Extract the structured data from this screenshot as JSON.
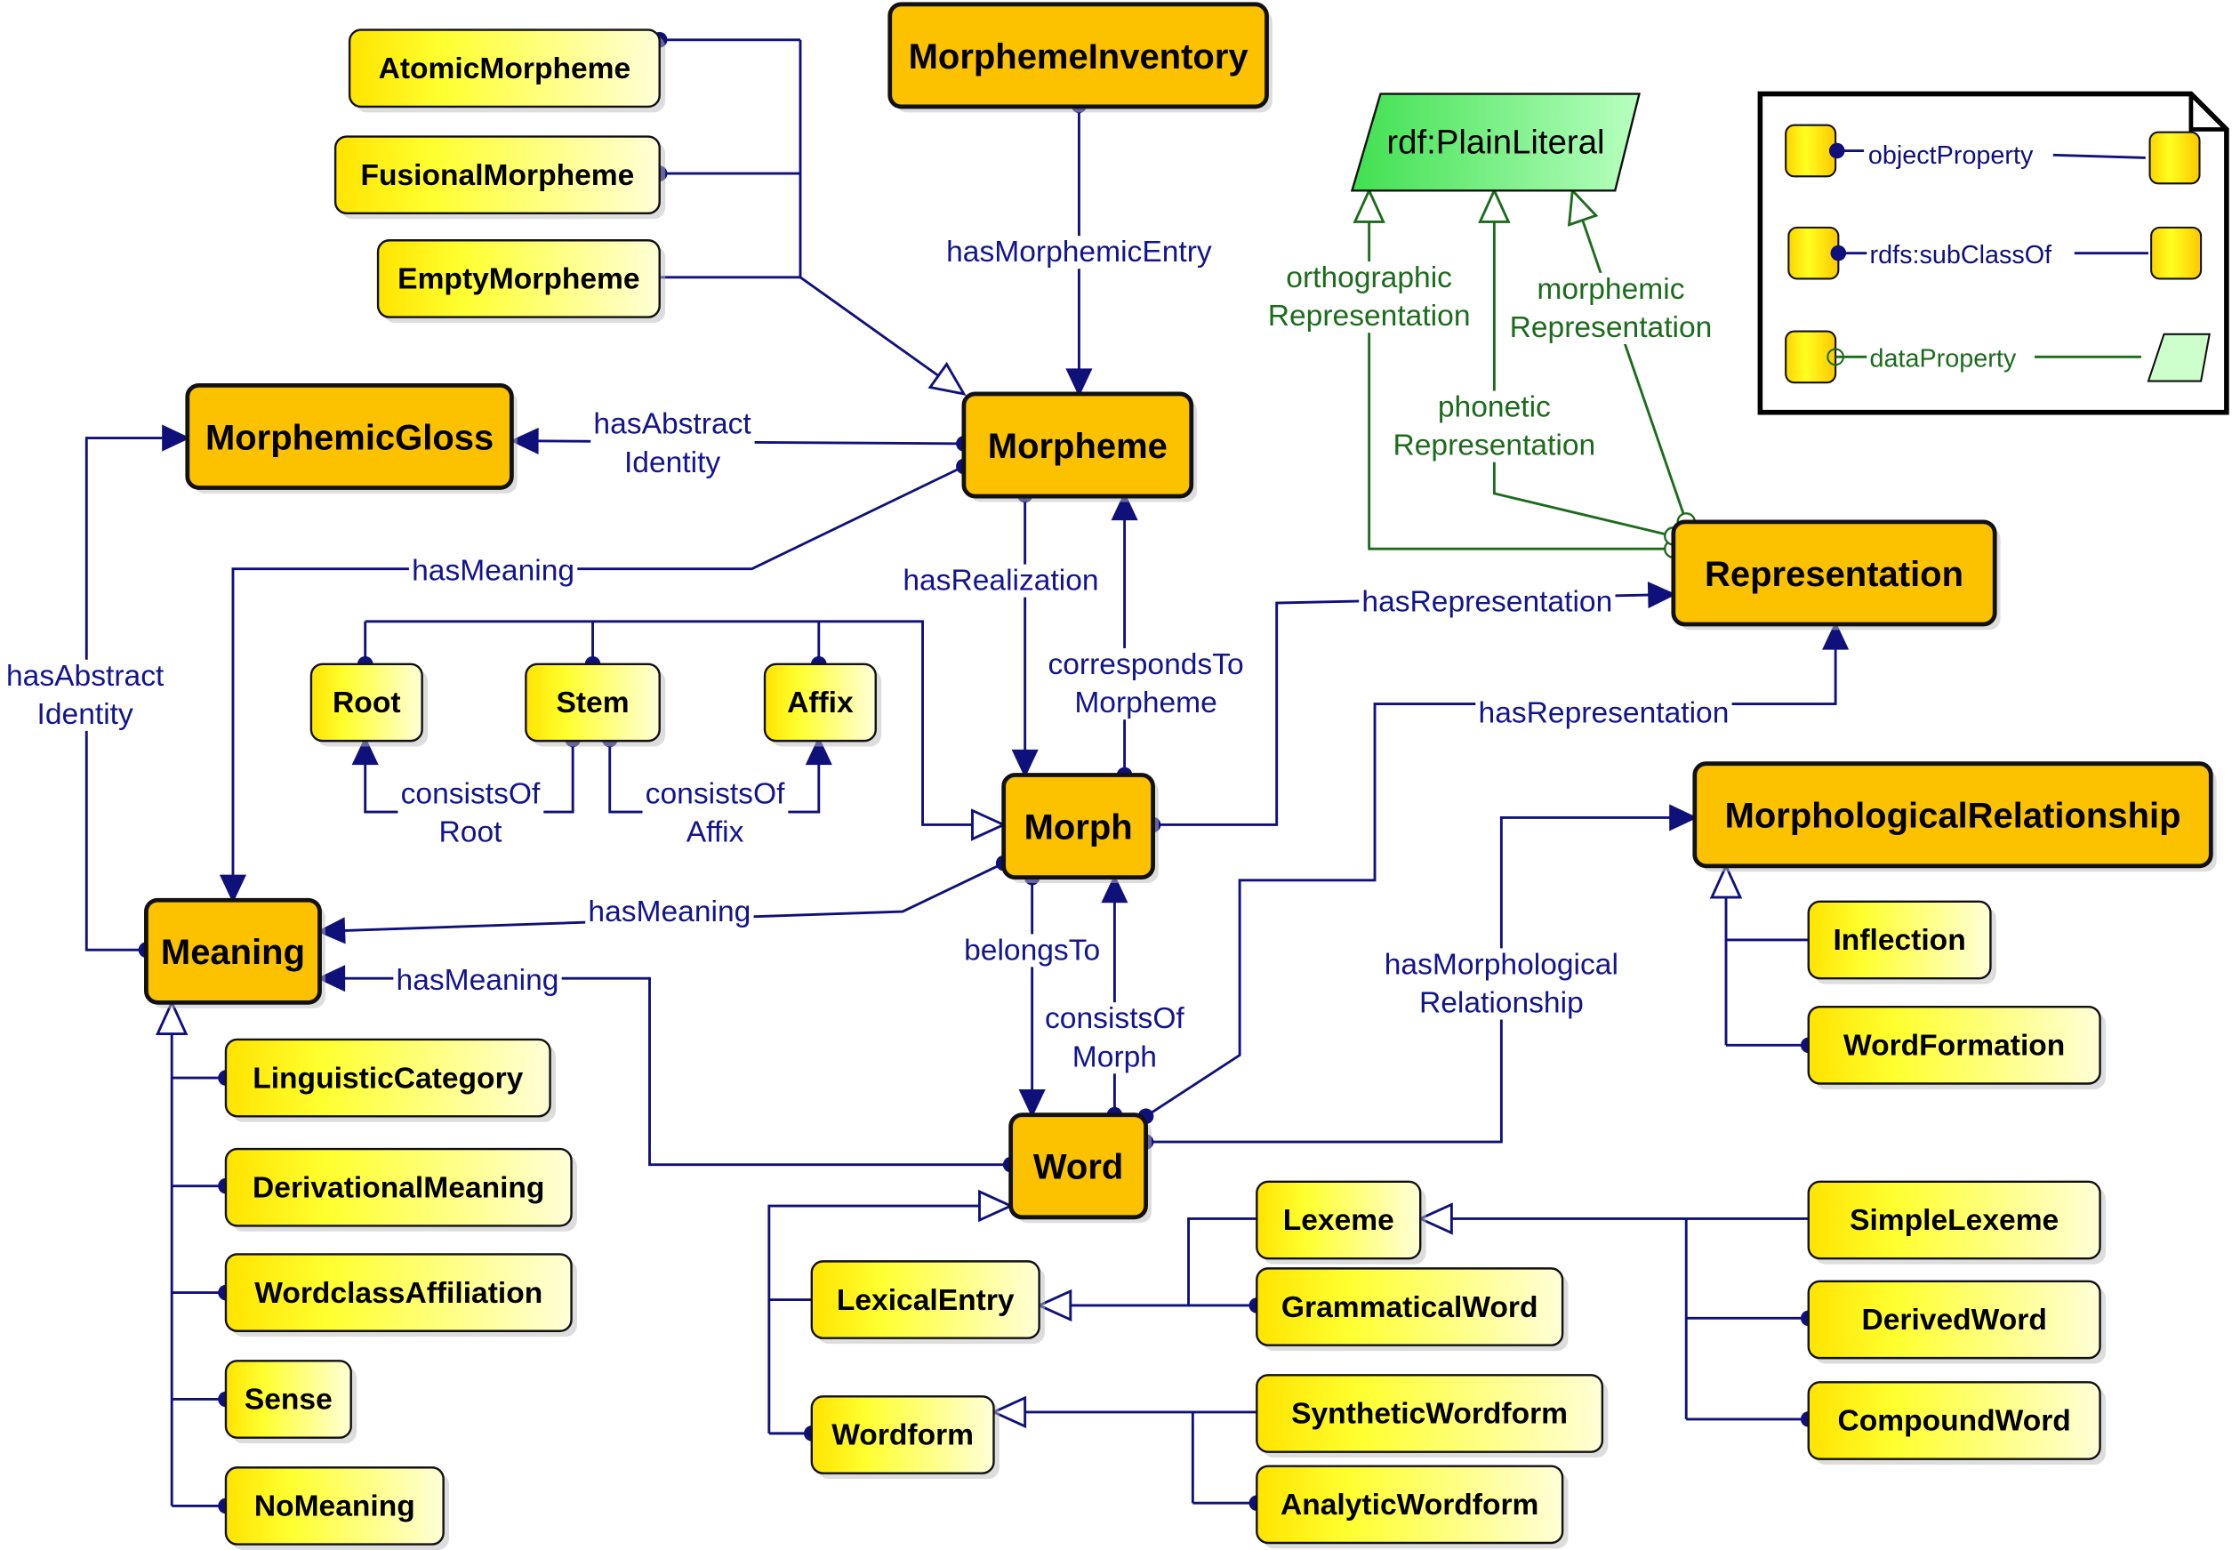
{
  "colors": {
    "major": "#fcc200",
    "minor_light": "#ffff30",
    "object_edge": "#10107a",
    "data_edge": "#1d6b1d",
    "literal": "#5cf06a"
  },
  "nodes": {
    "MorphemeInventory": "MorphemeInventory",
    "Morpheme": "Morpheme",
    "MorphemicGloss": "MorphemicGloss",
    "Representation": "Representation",
    "Morph": "Morph",
    "Meaning": "Meaning",
    "Word": "Word",
    "MorphologicalRelationship": "MorphologicalRelationship",
    "AtomicMorpheme": "AtomicMorpheme",
    "FusionalMorpheme": "FusionalMorpheme",
    "EmptyMorpheme": "EmptyMorpheme",
    "Root": "Root",
    "Stem": "Stem",
    "Affix": "Affix",
    "Inflection": "Inflection",
    "WordFormation": "WordFormation",
    "LinguisticCategory": "LinguisticCategory",
    "DerivationalMeaning": "DerivationalMeaning",
    "WordclassAffiliation": "WordclassAffiliation",
    "Sense": "Sense",
    "NoMeaning": "NoMeaning",
    "Lexeme": "Lexeme",
    "GrammaticalWord": "GrammaticalWord",
    "SimpleLexeme": "SimpleLexeme",
    "DerivedWord": "DerivedWord",
    "CompoundWord": "CompoundWord",
    "LexicalEntry": "LexicalEntry",
    "Wordform": "Wordform",
    "SyntheticWordform": "SyntheticWordform",
    "AnalyticWordform": "AnalyticWordform",
    "PlainLiteral": "rdf:PlainLiteral"
  },
  "edge_labels": [
    [
      "hasMorphemicEntry"
    ],
    [
      "hasAbstract",
      "Identity"
    ],
    [
      "hasMeaning"
    ],
    [
      "hasRealization"
    ],
    [
      "correspondsTo",
      "Morpheme"
    ],
    [
      "hasRepresentation"
    ],
    [
      "hasRepresentation"
    ],
    [
      "hasMorphological",
      "Relationship"
    ],
    [
      "hasMeaning"
    ],
    [
      "hasMeaning"
    ],
    [
      "belongsTo"
    ],
    [
      "consistsOf",
      "Morph"
    ],
    [
      "consistsOf",
      "Root"
    ],
    [
      "consistsOf",
      "Affix"
    ],
    [
      "hasAbstract",
      "Identity"
    ],
    [
      "orthographic",
      "Representation"
    ],
    [
      "phonetic",
      "Representation"
    ],
    [
      "morphemic",
      "Representation"
    ]
  ],
  "legend": {
    "object_property": "objectProperty",
    "subclass": "rdfs:subClassOf",
    "data_property": "dataProperty"
  }
}
